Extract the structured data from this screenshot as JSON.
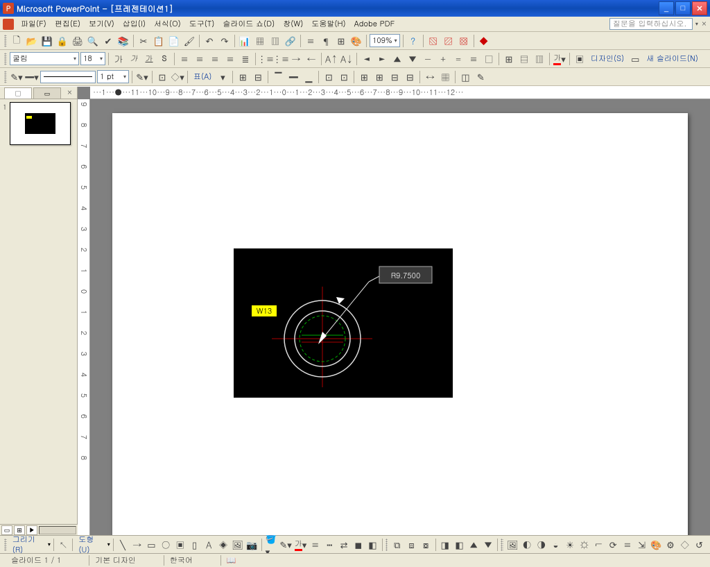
{
  "app": {
    "title": "Microsoft PowerPoint - [프레젠테이션1]"
  },
  "menubar": {
    "items": [
      "파일(F)",
      "편집(E)",
      "보기(V)",
      "삽입(I)",
      "서식(O)",
      "도구(T)",
      "슬라이드 쇼(D)",
      "창(W)",
      "도움말(H)",
      "Adobe PDF"
    ],
    "searchPlaceholder": "질문을 입력하십시오."
  },
  "toolbar1": {
    "zoom": "109%"
  },
  "toolbar2": {
    "font": "굴림",
    "size": "18",
    "design": "디자인(S)",
    "newslide": "새 슬라이드(N)"
  },
  "toolbar3": {
    "lw": "1 pt",
    "table": "표(A)"
  },
  "ruler": {
    "h": "···1···●···11···10···9···8···7···6···5···4···3···2···1···0···1···2···3···4···5···6···7···8···9···10···11···12···",
    "v": "9 8 7 6 5 4 3 2 1 0 1 2 3 4 5 6 7 8"
  },
  "thumb": {
    "num": "1",
    "tab1": "□",
    "tab2": "▭",
    "close": "×"
  },
  "slide": {
    "label_w": "W13",
    "label_r": "R9.7500"
  },
  "drawbar": {
    "draw": "그리기(R)",
    "shapes": "도형(U)"
  },
  "status": {
    "s1": "슬라이드 1 / 1",
    "s2": "기본 디자인",
    "s3": "한국어"
  }
}
